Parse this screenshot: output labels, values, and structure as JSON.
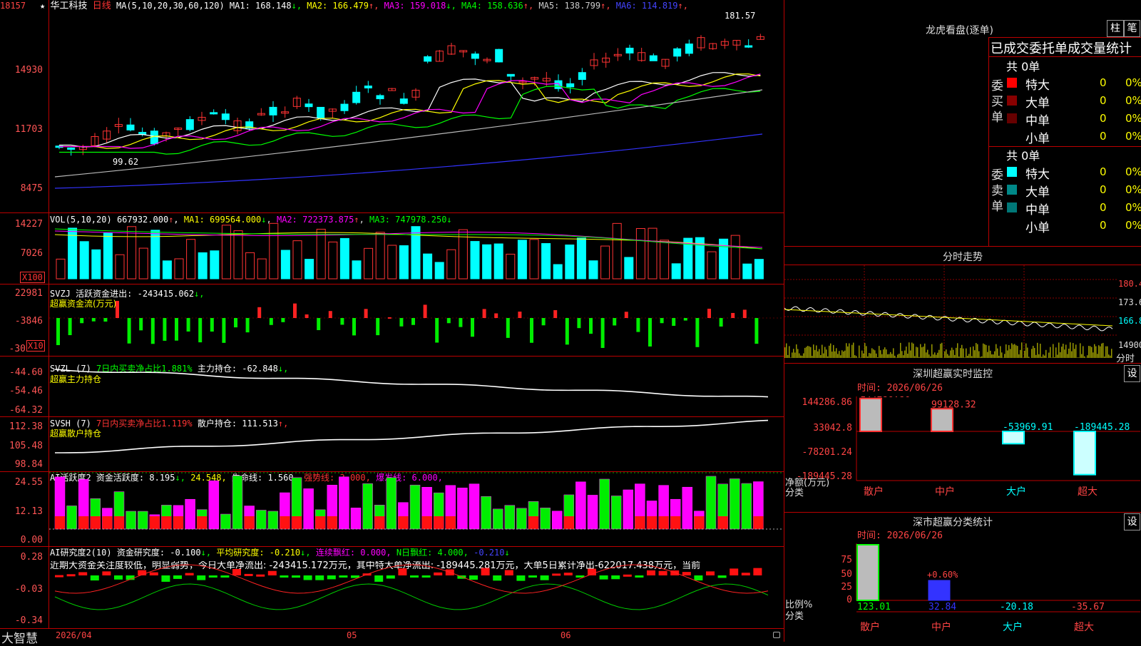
{
  "stock": {
    "star": "★",
    "name": "华工科技",
    "period": "日线",
    "ma_label": "MA(5,10,20,30,60,120)"
  },
  "ma_values": [
    {
      "label": "MA1: 168.148",
      "arrow": "↓",
      "color": "#ffffff"
    },
    {
      "label": "MA2: 166.479",
      "arrow": "↑",
      "color": "#ffff00"
    },
    {
      "label": "MA3: 159.018",
      "arrow": "↓",
      "color": "#ff00ff"
    },
    {
      "label": "MA4: 158.636",
      "arrow": "↑",
      "color": "#00ff00"
    },
    {
      "label": "MA5: 138.799",
      "arrow": "↑",
      "color": "#cccccc"
    },
    {
      "label": "MA6: 114.819",
      "arrow": "↑",
      "color": "#4444ff"
    }
  ],
  "price_axis": [
    "18157",
    "14930",
    "11703",
    "8475"
  ],
  "price_hi": "181.57",
  "price_lo": "99.62",
  "vol": {
    "title": "VOL(5,10,20)",
    "value": "667932.000",
    "arrow": "↑",
    "ma1": "MA1: 699564.000",
    "ma1a": "↓",
    "ma2": "MA2: 722373.875",
    "ma2a": "↑",
    "ma3": "MA3: 747978.250",
    "ma3a": "↓",
    "axis": [
      "14227",
      "7026"
    ],
    "unit": "X100"
  },
  "svzj": {
    "title": "SVZJ",
    "desc": "活跃资金进出: -243415.062",
    "arrow": "↓,",
    "sub": "超赢资金流(万元)",
    "axis": [
      "22981",
      "-3846",
      "-30"
    ],
    "unit": "X10"
  },
  "svzl": {
    "title": "SVZL (7)",
    "p1": "7日内买卖净占比1.881%",
    "p2": "主力持仓: -62.848",
    "arrow": "↓,",
    "sub": "超赢主力持仓",
    "axis": [
      "-44.60",
      "-54.46",
      "-64.32"
    ]
  },
  "svsh": {
    "title": "SVSH (7)",
    "p1": "7日内买卖净占比1.119%",
    "p2": "散户持仓: 111.513",
    "arrow": "↑,",
    "sub": "超赢散户持仓",
    "axis": [
      "112.38",
      "105.48",
      "98.84"
    ]
  },
  "ai1": {
    "title": "AI活跃度2",
    "a": "资金活跃度: 8.195",
    "aa": "↓,",
    "b": "24.548,",
    "c": "生命线: 1.560,",
    "d": "强势线: 3.000,",
    "e": "爆发线: 6.000,",
    "axis": [
      "24.55",
      "12.13",
      "0.00"
    ]
  },
  "ai2": {
    "title": "AI研究度2(10)",
    "a": "资金研究度: -0.100",
    "aa": "↓,",
    "b": "平均研究度: -0.210",
    "ba": "↓,",
    "c": "连续飘红: 0.000,",
    "d": "N日飘红: 4.000,",
    "e": "-0.210",
    "ea": "↓",
    "axis": [
      "0.28",
      "-0.03",
      "-0.34"
    ],
    "comment": "近期大资金关注度较低，明显弱势，今日大单净流出: -243415.172万元，其中特大单净流出: -189445.281万元，大单5日累计净出-622017.438万元，当前"
  },
  "bottom": {
    "logo": "大智慧",
    "dates": [
      "2026/04",
      "05",
      "06"
    ]
  },
  "dragon": {
    "title": "龙虎看盘(逐单)",
    "btn1": "柱",
    "btn2": "笔",
    "header": "已成交委托单成交量统计",
    "buy": {
      "label": "委买单",
      "total": "共 0单",
      "rows": [
        {
          "name": "特大",
          "count": "0",
          "pct": "0%",
          "color": "#ff0000"
        },
        {
          "name": "大单",
          "count": "0",
          "pct": "0%",
          "color": "#880000"
        },
        {
          "name": "中单",
          "count": "0",
          "pct": "0%",
          "color": "#660000"
        },
        {
          "name": "小单",
          "count": "0",
          "pct": "0%",
          "color": ""
        }
      ]
    },
    "sell": {
      "label": "委卖单",
      "total": "共 0单",
      "rows": [
        {
          "name": "特大",
          "count": "0",
          "pct": "0%",
          "color": "#00ffff"
        },
        {
          "name": "大单",
          "count": "0",
          "pct": "0%",
          "color": "#008888"
        },
        {
          "name": "中单",
          "count": "0",
          "pct": "0%",
          "color": "#007777"
        },
        {
          "name": "小单",
          "count": "0",
          "pct": "0%",
          "color": ""
        }
      ]
    }
  },
  "intraday": {
    "title": "分时走势",
    "axis": [
      "180.4",
      "173.6",
      "166.8",
      "14900"
    ],
    "unit": "分时"
  },
  "monitor": {
    "title": "深圳超赢实时监控",
    "btn": "设",
    "time": "时间: 2026/06/26",
    "axis": [
      "144286.86",
      "33042.8",
      "-78201.24",
      "-189445.28"
    ],
    "ylabel": "净额(万元)",
    "xlabel": "分类",
    "cats": [
      {
        "name": "散户",
        "value": 144286.86,
        "label": "144286.86"
      },
      {
        "name": "中户",
        "value": 99128.32,
        "label": "99128.32"
      },
      {
        "name": "大户",
        "value": -53969.91,
        "label": "-53969.91"
      },
      {
        "name": "超大",
        "value": -189445.28,
        "label": "-189445.28"
      }
    ]
  },
  "classify": {
    "title": "深市超赢分类统计",
    "btn": "设",
    "time": "时间: 2026/06/26",
    "axis": [
      "75",
      "50",
      "25",
      "0"
    ],
    "ylabel": "比例%",
    "xlabel": "分类",
    "pct_label": "+0.60%",
    "cats": [
      {
        "name": "散户",
        "value": "123.01"
      },
      {
        "name": "中户",
        "value": "32.84"
      },
      {
        "name": "大户",
        "value": "-20.18"
      },
      {
        "name": "超大",
        "value": "-35.67"
      }
    ]
  }
}
